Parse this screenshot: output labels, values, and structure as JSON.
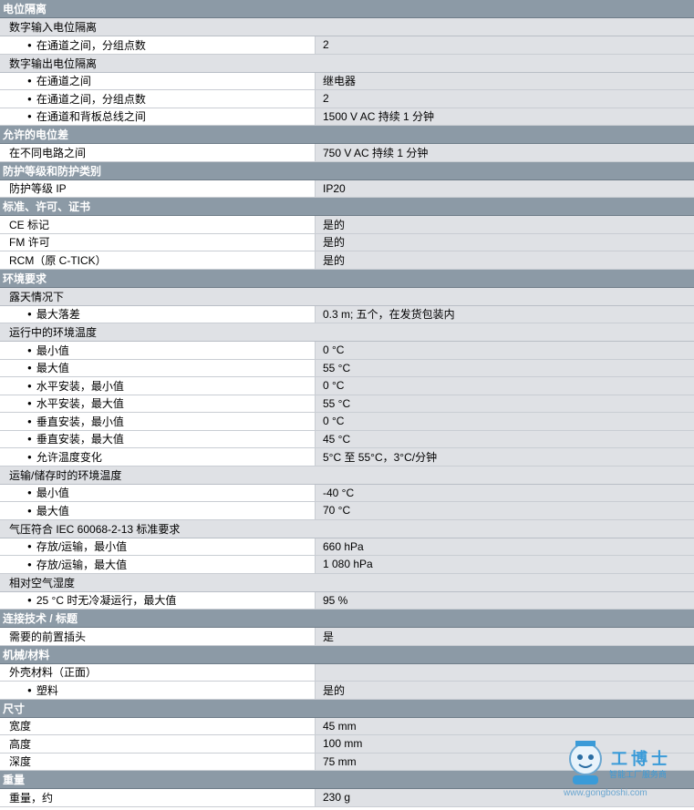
{
  "sections": [
    {
      "title": "电位隔离",
      "rows": [
        {
          "type": "group",
          "label": "数字输入电位隔离"
        },
        {
          "type": "bullet",
          "label": "在通道之间，分组点数",
          "value": "2"
        },
        {
          "type": "group",
          "label": "数字输出电位隔离"
        },
        {
          "type": "bullet",
          "label": "在通道之间",
          "value": "继电器"
        },
        {
          "type": "bullet",
          "label": "在通道之间，分组点数",
          "value": "2"
        },
        {
          "type": "bullet",
          "label": "在通道和背板总线之间",
          "value": "1500 V AC 持续 1 分钟"
        }
      ]
    },
    {
      "title": "允许的电位差",
      "rows": [
        {
          "type": "item",
          "label": "在不同电路之间",
          "value": "750 V AC 持续 1 分钟"
        }
      ]
    },
    {
      "title": "防护等级和防护类别",
      "rows": [
        {
          "type": "item",
          "label": "防护等级 IP",
          "value": "IP20"
        }
      ]
    },
    {
      "title": "标准、许可、证书",
      "rows": [
        {
          "type": "item",
          "label": "CE 标记",
          "value": "是的"
        },
        {
          "type": "item",
          "label": "FM 许可",
          "value": "是的"
        },
        {
          "type": "item",
          "label": "RCM（原 C-TICK）",
          "value": "是的"
        }
      ]
    },
    {
      "title": "环境要求",
      "rows": [
        {
          "type": "group",
          "label": "露天情况下"
        },
        {
          "type": "bullet",
          "label": "最大落差",
          "value": "0.3 m; 五个，在发货包装内"
        },
        {
          "type": "group",
          "label": "运行中的环境温度"
        },
        {
          "type": "bullet",
          "label": "最小值",
          "value": "0 °C"
        },
        {
          "type": "bullet",
          "label": "最大值",
          "value": "55 °C"
        },
        {
          "type": "bullet",
          "label": "水平安装，最小值",
          "value": "0 °C"
        },
        {
          "type": "bullet",
          "label": "水平安装，最大值",
          "value": "55 °C"
        },
        {
          "type": "bullet",
          "label": "垂直安装，最小值",
          "value": "0 °C"
        },
        {
          "type": "bullet",
          "label": "垂直安装，最大值",
          "value": "45 °C"
        },
        {
          "type": "bullet",
          "label": "允许温度变化",
          "value": "5°C 至 55°C，3°C/分钟"
        },
        {
          "type": "group",
          "label": "运输/储存时的环境温度"
        },
        {
          "type": "bullet",
          "label": "最小值",
          "value": "-40 °C"
        },
        {
          "type": "bullet",
          "label": "最大值",
          "value": "70 °C"
        },
        {
          "type": "group",
          "label": "气压符合 IEC 60068-2-13 标准要求"
        },
        {
          "type": "bullet",
          "label": "存放/运输，最小值",
          "value": "660 hPa"
        },
        {
          "type": "bullet",
          "label": "存放/运输，最大值",
          "value": "1 080 hPa"
        },
        {
          "type": "group",
          "label": "相对空气湿度"
        },
        {
          "type": "bullet",
          "label": "25 °C 时无冷凝运行，最大值",
          "value": "95 %"
        }
      ]
    },
    {
      "title": "连接技术 / 标题",
      "rows": [
        {
          "type": "item",
          "label": "需要的前置插头",
          "value": "是"
        }
      ]
    },
    {
      "title": "机械/材料",
      "rows": [
        {
          "type": "item",
          "label": "外壳材料（正面）",
          "value": ""
        },
        {
          "type": "bullet",
          "label": "塑料",
          "value": "是的"
        }
      ]
    },
    {
      "title": "尺寸",
      "rows": [
        {
          "type": "item",
          "label": "宽度",
          "value": "45 mm"
        },
        {
          "type": "item",
          "label": "高度",
          "value": "100 mm"
        },
        {
          "type": "item",
          "label": "深度",
          "value": "75 mm"
        }
      ]
    },
    {
      "title": "重量",
      "rows": [
        {
          "type": "item",
          "label": "重量，约",
          "value": "230 g"
        }
      ]
    }
  ],
  "watermark": {
    "brand": "工博士",
    "subtitle": "智能工厂服务商",
    "url": "www.gongboshi.com"
  },
  "colors": {
    "section_bg": "#8c9aa6",
    "group_bg": "#dfe1e5",
    "value_bg": "#dfe1e5",
    "brand_blue": "#3a9bd8"
  }
}
